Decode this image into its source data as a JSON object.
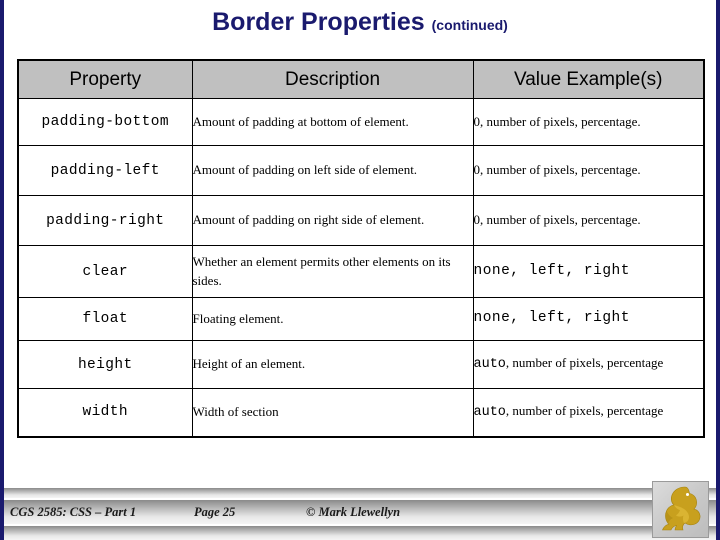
{
  "slide": {
    "title": "Border Properties",
    "title_suffix": "(continued)",
    "title_color": "#1a1a6e"
  },
  "table": {
    "header_bg": "#c0c0c0",
    "columns": [
      "Property",
      "Description",
      "Value Example(s)"
    ],
    "rows": [
      {
        "property": "padding-bottom",
        "description": "Amount of padding at bottom of element.",
        "value": "0, number of pixels, percentage.",
        "value_style": "serif"
      },
      {
        "property": "padding-left",
        "description": "Amount of padding on left side of element.",
        "value": "0, number of pixels, percentage.",
        "value_style": "serif"
      },
      {
        "property": "padding-right",
        "description": "Amount of padding on right side of element.",
        "value": "0, number of pixels, percentage.",
        "value_style": "serif"
      },
      {
        "property": "clear",
        "description": "Whether an element permits other elements on its sides.",
        "value": "none, left, right",
        "value_style": "mono"
      },
      {
        "property": "float",
        "description": "Floating element.",
        "value": "none, left, right",
        "value_style": "mono"
      },
      {
        "property": "height",
        "description": "Height of an element.",
        "value_keyword": "auto",
        "value_rest": ", number of pixels, percentage",
        "value_style": "mixed"
      },
      {
        "property": "width",
        "description": "Width of section",
        "value_keyword": "auto",
        "value_rest": ", number of pixels, percentage",
        "value_style": "mixed"
      }
    ]
  },
  "footer": {
    "course": "CGS 2585: CSS – Part 1",
    "page": "Page 25",
    "copyright": "© Mark Llewellyn"
  },
  "logo": {
    "name": "ucf-pegasus-logo",
    "color": "#c8a01e"
  }
}
